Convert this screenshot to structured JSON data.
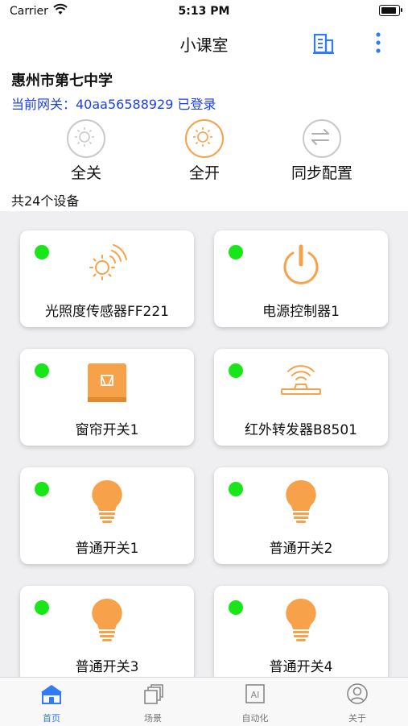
{
  "status_bar": {
    "carrier": "Carrier",
    "time": "5:13 PM"
  },
  "nav": {
    "title": "小课室"
  },
  "header": {
    "school": "惠州市第七中学",
    "gateway": "当前网关：40aa56588929 已登录"
  },
  "actions": {
    "all_off": "全关",
    "all_on": "全开",
    "sync": "同步配置"
  },
  "device_count": "共24个设备",
  "devices": [
    {
      "name": "光照度传感器FF221",
      "icon": "light-sensor-icon",
      "online": true
    },
    {
      "name": "电源控制器1",
      "icon": "power-icon",
      "online": true
    },
    {
      "name": "窗帘开关1",
      "icon": "curtain-icon",
      "online": true
    },
    {
      "name": "红外转发器B8501",
      "icon": "ir-transmitter-icon",
      "online": true
    },
    {
      "name": "普通开关1",
      "icon": "bulb-icon",
      "online": true
    },
    {
      "name": "普通开关2",
      "icon": "bulb-icon",
      "online": true
    },
    {
      "name": "普通开关3",
      "icon": "bulb-icon",
      "online": true
    },
    {
      "name": "普通开关4",
      "icon": "bulb-icon",
      "online": true
    }
  ],
  "tabs": [
    {
      "label": "首页",
      "active": true
    },
    {
      "label": "场景",
      "active": false
    },
    {
      "label": "自动化",
      "active": false
    },
    {
      "label": "关于",
      "active": false
    }
  ],
  "colors": {
    "accent_orange": "#f7a24a",
    "online_green": "#19e619",
    "link_blue": "#1a3ff0",
    "tab_active": "#2f7cf6"
  }
}
